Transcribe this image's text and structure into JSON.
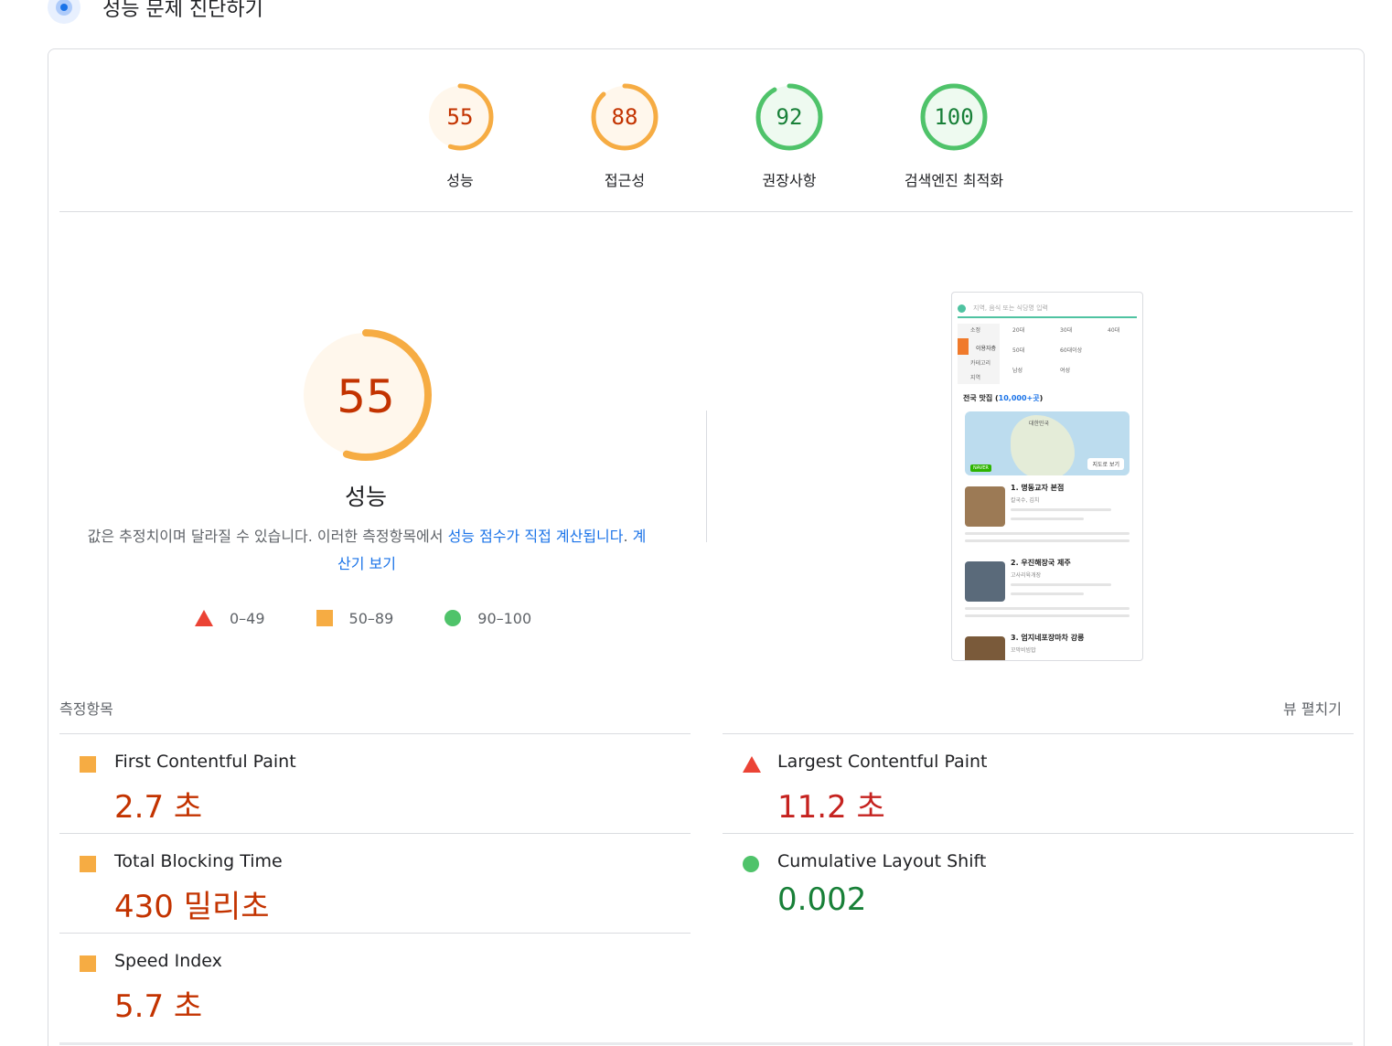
{
  "header": {
    "title": "성능 문제 진단하기",
    "icon": "lighthouse-gauge-icon"
  },
  "colors": {
    "average": "#f6ac43",
    "average_text": "#c33300",
    "average_fill": "#fff7ec",
    "pass": "#4fc36a",
    "pass_text": "#188038",
    "pass_fill": "#eefaf0",
    "fail": "#eb4335",
    "link": "#1a73e8"
  },
  "scores": [
    {
      "label": "성능",
      "score": 55
    },
    {
      "label": "접근성",
      "score": 88
    },
    {
      "label": "권장사항",
      "score": 92
    },
    {
      "label": "검색엔진 최적화",
      "score": 100
    }
  ],
  "performance": {
    "score": 55,
    "label": "성능",
    "note_text": "값은 추정치이며 달라질 수 있습니다. 이러한 측정항목에서 ",
    "note_link": "성능 점수가 직접 계산됩니다",
    "note_end": ". ",
    "calculator_link": "계산기 보기"
  },
  "legend": [
    {
      "range": "0–49",
      "shape": "triangle"
    },
    {
      "range": "50–89",
      "shape": "square"
    },
    {
      "range": "90–100",
      "shape": "circle"
    }
  ],
  "screenshot": {
    "search_placeholder": "지역, 음식 또는 식당명 입력",
    "tabs": [
      "소정",
      "이용자층",
      "카테고리",
      "지역"
    ],
    "options": [
      "20대",
      "30대",
      "40대",
      "50대",
      "60대이상",
      "남성",
      "여성"
    ],
    "heading_prefix": "전국 맛집 (",
    "heading_count": "10,000+곳",
    "heading_suffix": ")",
    "map_label": "대한민국",
    "map_button": "지도로 보기",
    "map_brand": "NAVER",
    "items": [
      {
        "name": "1. 명동교자 본점",
        "sub": "칼국수, 김치"
      },
      {
        "name": "2. 우진해장국 제주",
        "sub": "고사리육개장"
      },
      {
        "name": "3. 엄지네포장마차 강릉",
        "sub": "꼬막비빔밥"
      }
    ]
  },
  "metrics": {
    "title": "측정항목",
    "expand_label": "뷰 펼치기",
    "left": [
      {
        "name": "First Contentful Paint",
        "value": "2.7 초",
        "status": "average"
      },
      {
        "name": "Total Blocking Time",
        "value": "430 밀리초",
        "status": "average"
      },
      {
        "name": "Speed Index",
        "value": "5.7 초",
        "status": "average"
      }
    ],
    "right": [
      {
        "name": "Largest Contentful Paint",
        "value": "11.2 초",
        "status": "fail"
      },
      {
        "name": "Cumulative Layout Shift",
        "value": "0.002",
        "status": "pass"
      }
    ]
  }
}
